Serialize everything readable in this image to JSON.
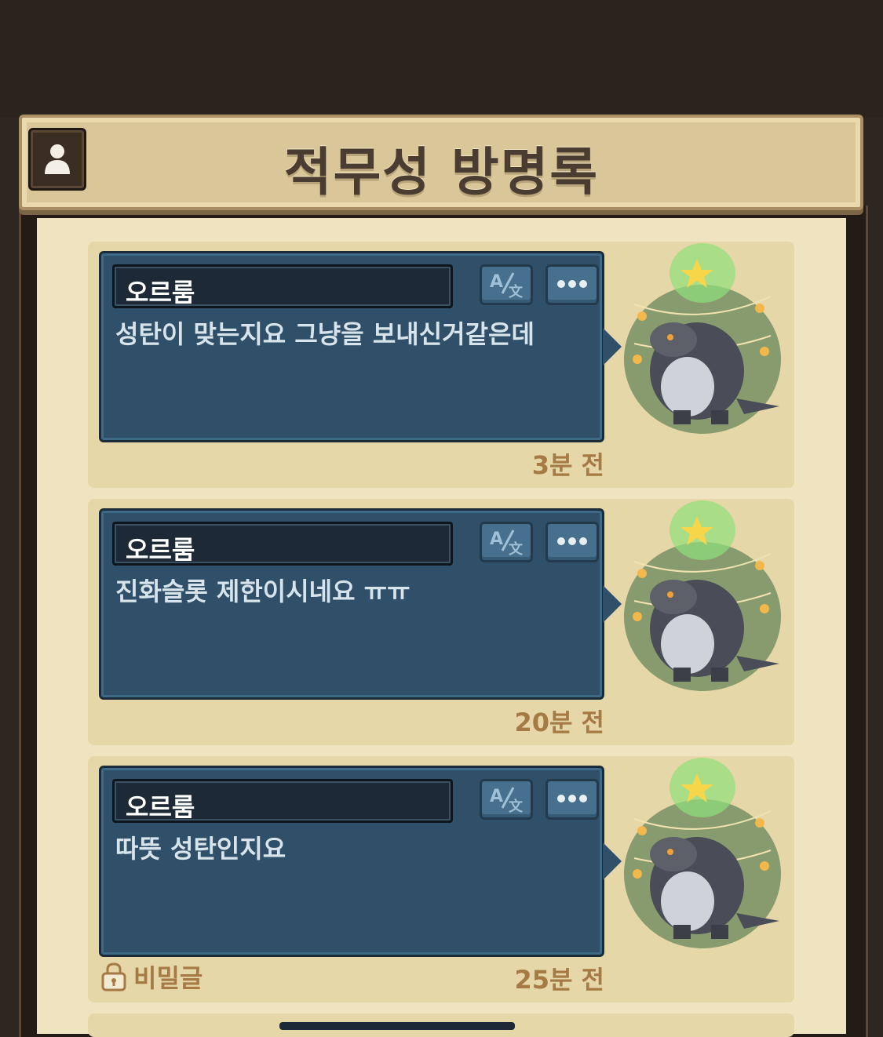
{
  "header": {
    "title": "적무성 방명록"
  },
  "entries": [
    {
      "author": "오르룸",
      "message": "성탄이 맞는지요 그냥을 보내신거같은데",
      "time": "3분 전",
      "secret": null
    },
    {
      "author": "오르룸",
      "message": "진화슬롯 제한이시네요 ㅠㅠ",
      "time": "20분 전",
      "secret": null
    },
    {
      "author": "오르룸",
      "message": "따뜻 성탄인지요",
      "time": "25분 전",
      "secret": "비밀글"
    }
  ],
  "icons": {
    "profile": "person-icon",
    "translate": "translate-icon",
    "more": "more-dots-icon",
    "lock": "lock-icon",
    "avatar": "dinosaur-christmas-tree-avatar"
  },
  "colors": {
    "bubble": "#2f5068",
    "time_text": "#a57a45",
    "banner": "#d9c79a"
  }
}
